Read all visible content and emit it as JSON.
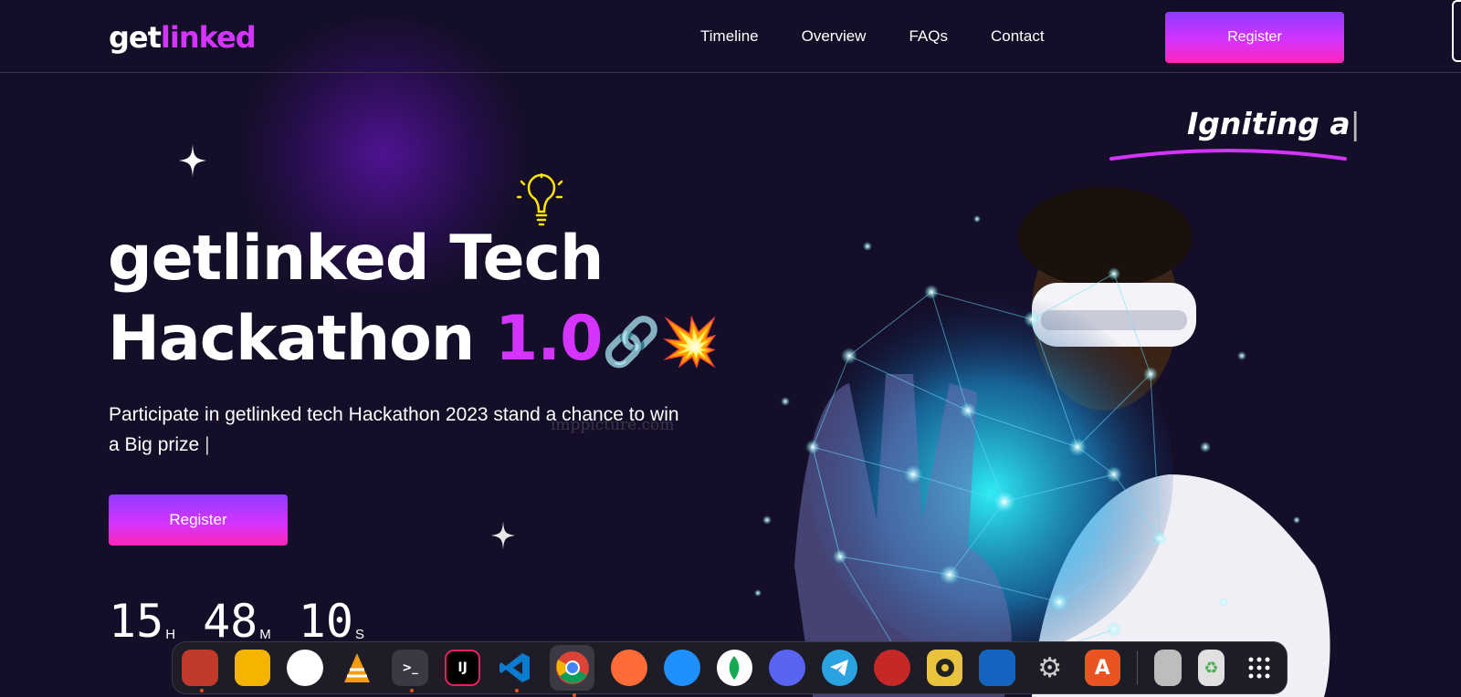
{
  "nav": {
    "logo_left": "get",
    "logo_right": "linked",
    "links": [
      "Timeline",
      "Overview",
      "FAQs",
      "Contact"
    ],
    "register_label": "Register"
  },
  "hero": {
    "tagline": "Igniting a",
    "tagline_cursor": "|",
    "title_line1": "getlinked Tech",
    "title_line2_word": "Hackathon",
    "title_version": "1.0",
    "title_emoji1": "🔗",
    "title_emoji2": "💥",
    "subtitle": "Participate in getlinked tech Hackathon 2023 stand a chance to win a Big prize",
    "subtitle_cursor": "|",
    "watermark": "imppicture.com",
    "register_label": "Register"
  },
  "timer": {
    "hours": "15",
    "hours_unit": "H",
    "minutes": "48",
    "minutes_unit": "M",
    "seconds": "10",
    "seconds_unit": "S"
  },
  "dock": {
    "items": [
      {
        "name": "files-icon",
        "glyph": "",
        "color": "#c0392b",
        "running": true
      },
      {
        "name": "calculator-icon",
        "glyph": "",
        "color": "#f5b400",
        "running": false
      },
      {
        "name": "slack-icon",
        "glyph": "",
        "color": "#ffffff",
        "running": false
      },
      {
        "name": "vlc-icon",
        "glyph": "",
        "color": "#f39c12",
        "running": false
      },
      {
        "name": "terminal-icon",
        "glyph": ">_",
        "color": "#3a3a44",
        "running": true
      },
      {
        "name": "intellij-icon",
        "glyph": "IJ",
        "color": "#000000",
        "running": false
      },
      {
        "name": "vscode-icon",
        "glyph": "",
        "color": "#0b7bd1",
        "running": true
      },
      {
        "name": "chrome-icon",
        "glyph": "",
        "color": "#4285f4",
        "running": true
      },
      {
        "name": "postman-icon",
        "glyph": "",
        "color": "#ff6c37",
        "running": false
      },
      {
        "name": "cloud-db-icon",
        "glyph": "",
        "color": "#1e90ff",
        "running": false
      },
      {
        "name": "mongodb-icon",
        "glyph": "",
        "color": "#ffffff",
        "running": false
      },
      {
        "name": "discord-icon",
        "glyph": "",
        "color": "#5865f2",
        "running": false
      },
      {
        "name": "telegram-icon",
        "glyph": "",
        "color": "#2aa3e0",
        "running": false
      },
      {
        "name": "filezilla-icon",
        "glyph": "",
        "color": "#c62828",
        "running": false
      },
      {
        "name": "speaker-icon",
        "glyph": "",
        "color": "#e8c33b",
        "running": false
      },
      {
        "name": "document-viewer-icon",
        "glyph": "",
        "color": "#1565c0",
        "running": false
      },
      {
        "name": "settings-icon",
        "glyph": "⚙",
        "color": "#9e9e9e",
        "running": false
      },
      {
        "name": "app-store-icon",
        "glyph": "A",
        "color": "#e95420",
        "running": false
      }
    ],
    "after_sep": [
      {
        "name": "drive-icon",
        "glyph": "",
        "color": "#bdbdbd"
      },
      {
        "name": "trash-icon",
        "glyph": "♻",
        "color": "#e0e0e0"
      },
      {
        "name": "show-apps-icon",
        "glyph": "",
        "color": "transparent"
      }
    ]
  }
}
